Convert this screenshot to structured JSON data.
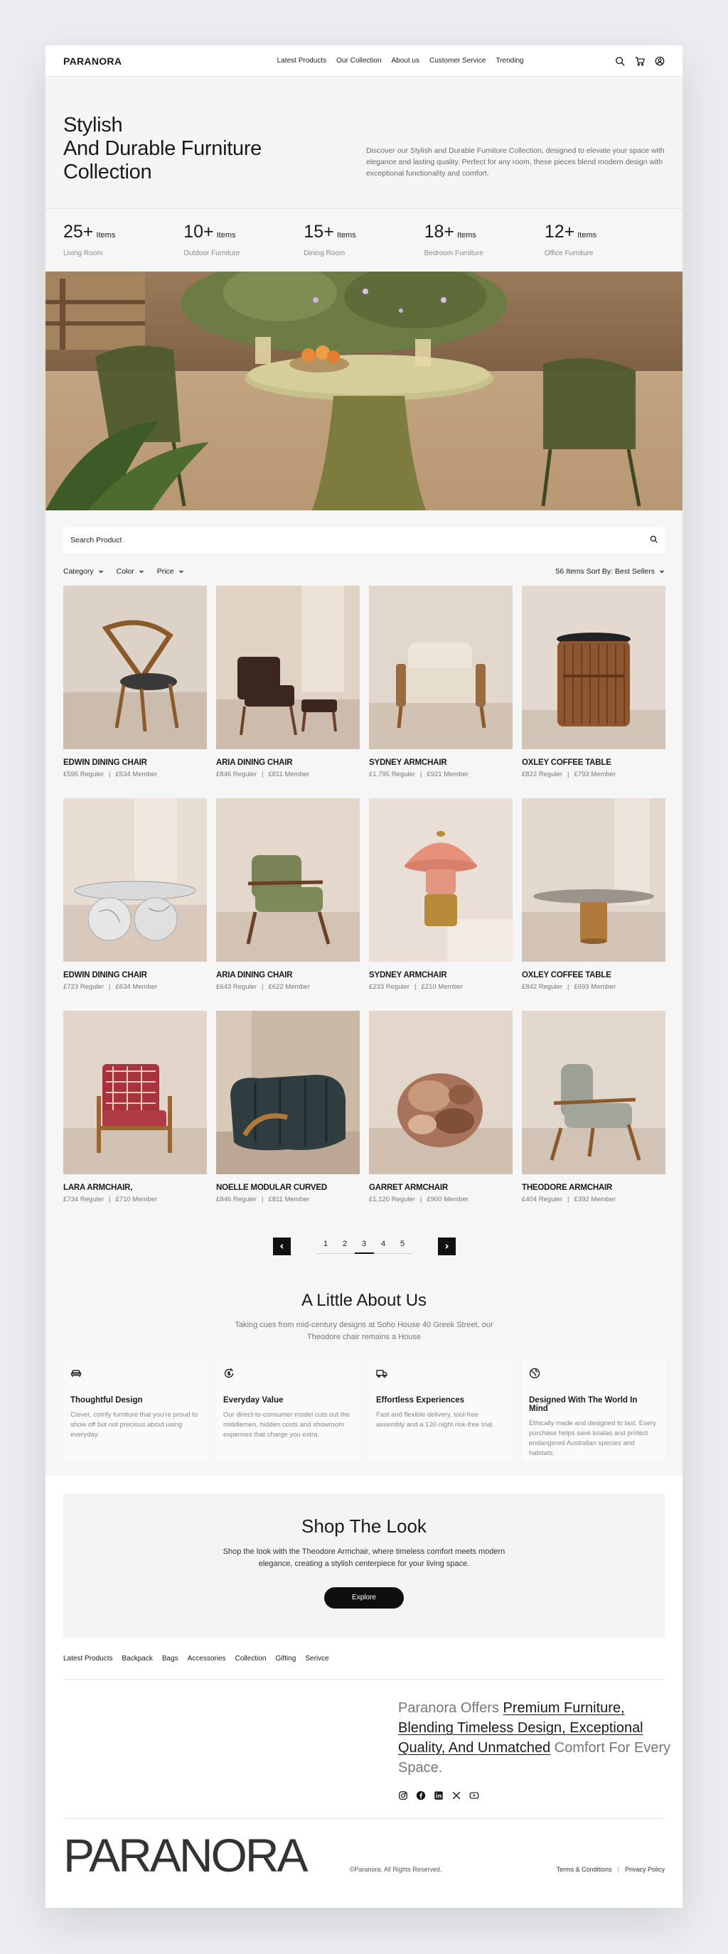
{
  "brand": "PARANORA",
  "nav": {
    "links": [
      "Latest Products",
      "Our Collection",
      "About us",
      "Customer Service",
      "Trending"
    ]
  },
  "hero": {
    "title": "Stylish\nAnd Durable Furniture\nCollection",
    "description": "Discover our Stylish and Durable Furniture Collection, designed to elevate your space with elegance and lasting quality. Perfect for any room, these pieces blend modern design with exceptional functionality and comfort."
  },
  "stats": [
    {
      "number": "25+",
      "unit": "Items",
      "label": "Living Room"
    },
    {
      "number": "10+",
      "unit": "Items",
      "label": "Outdoor Furniture"
    },
    {
      "number": "15+",
      "unit": "Items",
      "label": "Dining Room"
    },
    {
      "number": "18+",
      "unit": "Items",
      "label": "Bedroom Furniture"
    },
    {
      "number": "12+",
      "unit": "Items",
      "label": "Office Furniture"
    }
  ],
  "search": {
    "placeholder": "Search Product"
  },
  "filters": {
    "category": "Category",
    "color": "Color",
    "price": "Price",
    "sort": "56 Items Sort By: Best Sellers"
  },
  "products": [
    {
      "name": "EDWIN DINING CHAIR",
      "regular": "£595 Reguler",
      "member": "£534 Member"
    },
    {
      "name": "ARIA DINING CHAIR",
      "regular": "£846 Reguler",
      "member": "£811 Member"
    },
    {
      "name": "SYDNEY ARMCHAIR",
      "regular": "£1,795 Reguler",
      "member": "£921 Member"
    },
    {
      "name": "OXLEY COFFEE TABLE",
      "regular": "£822 Reguler",
      "member": "£793 Member"
    },
    {
      "name": "EDWIN DINING CHAIR",
      "regular": "£723 Reguler",
      "member": "£634 Member"
    },
    {
      "name": "ARIA DINING CHAIR",
      "regular": "£643 Reguler",
      "member": "£622 Member"
    },
    {
      "name": "SYDNEY ARMCHAIR",
      "regular": "£233 Reguler",
      "member": "£210 Member"
    },
    {
      "name": "OXLEY COFFEE TABLE",
      "regular": "£842 Reguler",
      "member": "£693 Member"
    },
    {
      "name": "LARA ARMCHAIR,",
      "regular": "£734 Reguler",
      "member": "£710 Member"
    },
    {
      "name": "NOELLE MODULAR CURVED",
      "regular": "£846 Reguler",
      "member": "£811 Member"
    },
    {
      "name": "GARRET ARMCHAIR",
      "regular": "£1,120 Reguler",
      "member": "£900 Member"
    },
    {
      "name": "THEODORE ARMCHAIR",
      "regular": "£404 Reguler",
      "member": "£392 Member"
    }
  ],
  "pagination": {
    "pages": [
      "1",
      "2",
      "3",
      "4",
      "5"
    ],
    "active": "3"
  },
  "about": {
    "title": "A Little About Us",
    "subtitle": "Taking cues from mid-century designs at Soho House 40 Greek Street, our Theodore chair remains a House",
    "features": [
      {
        "icon": "sofa-icon",
        "title": "Thoughtful Design",
        "text": "Clever, comfy furniture that you're proud to show off but not precious about using everyday."
      },
      {
        "icon": "dollar-cycle-icon",
        "title": "Everyday Value",
        "text": "Our direct-to-consumer model cuts out the middlemen, hidden costs and showroom expenses that charge you extra."
      },
      {
        "icon": "truck-icon",
        "title": "Effortless Experiences",
        "text": "Fast and flexible delivery, tool-free assembly and a 120 night risk-free trial."
      },
      {
        "icon": "globe-icon",
        "title": "Designed With The World In Mind",
        "text": "Ethically made and designed to last. Every purchase helps save koalas and protect endangered Australian species and habitats."
      }
    ]
  },
  "shop": {
    "title": "Shop The Look",
    "text": "Shop the look with the Theodore Armchair, where timeless comfort meets modern elegance, creating a stylish centerpiece for your living space.",
    "button": "Explore"
  },
  "footer": {
    "links": [
      "Latest Products",
      "Backpack",
      "Bags",
      "Accessories",
      "Collection",
      "Gifting",
      "Serivce"
    ],
    "promo_prefix": "Paranora Offers ",
    "promo_highlight": "Premium Furniture, Blending Timeless Design, Exceptional Quality, And Unmatched",
    "promo_suffix": " Comfort For Every Space.",
    "social": [
      "instagram-icon",
      "facebook-icon",
      "linkedin-icon",
      "x-icon",
      "youtube-icon"
    ],
    "big_logo": "PARANORA",
    "copyright": "©Paranora. All Rights Reserved.",
    "terms": "Terms & Conditions",
    "privacy": "Privacy Policy"
  }
}
